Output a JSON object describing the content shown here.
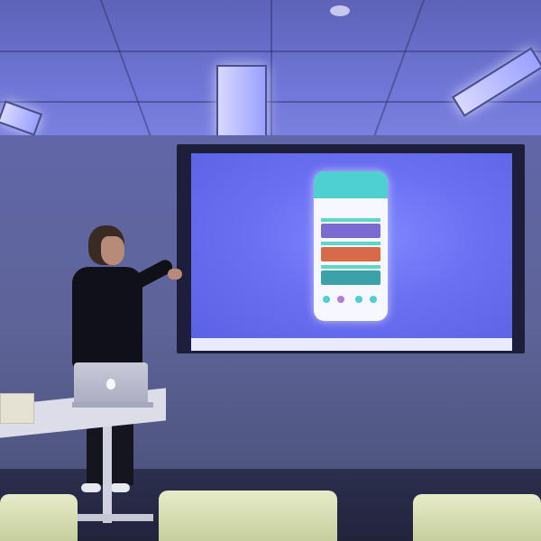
{
  "scene": {
    "description_colors": {
      "ceiling": "#6f76d6",
      "projection_screen": "#6b70f3",
      "phone_ui_accent": "#4ecfd0"
    },
    "icons": [
      "apple-logo-icon"
    ]
  }
}
